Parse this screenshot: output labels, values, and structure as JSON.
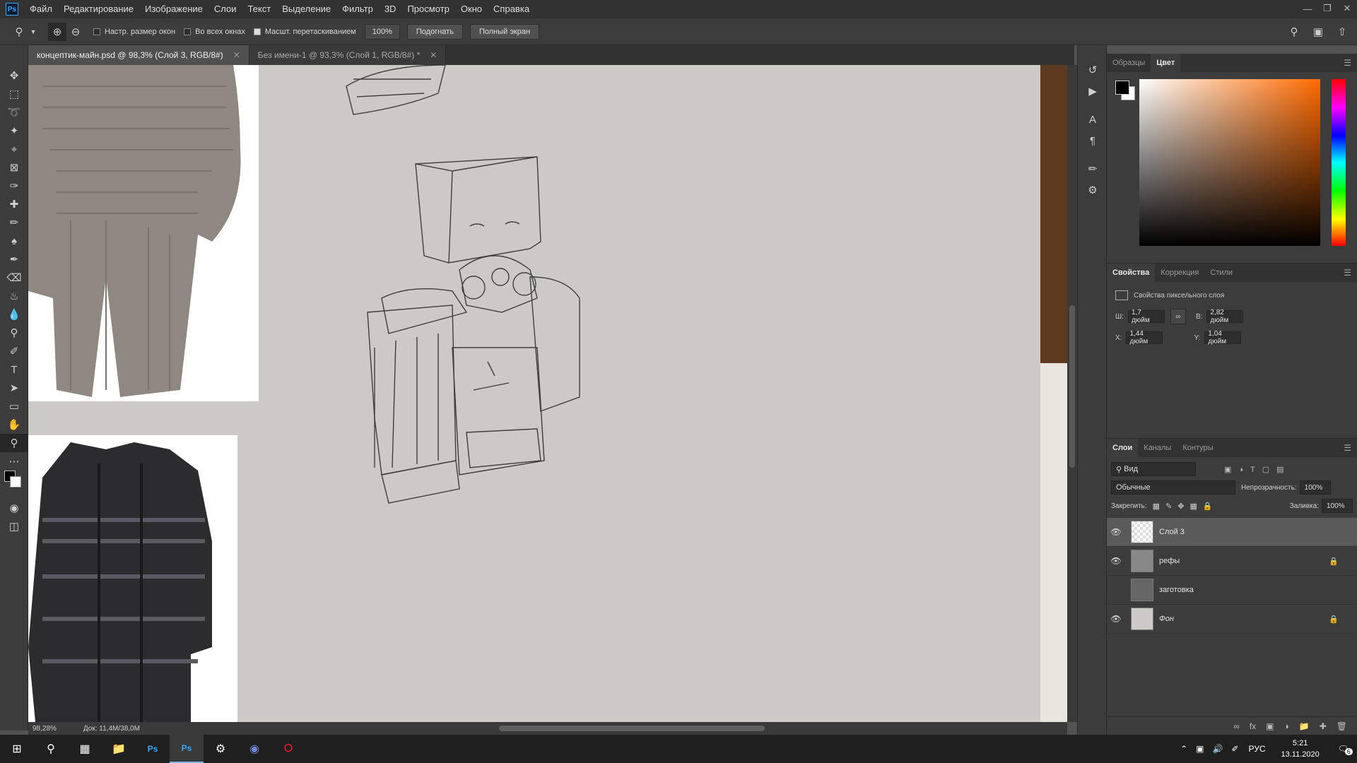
{
  "menu": [
    "Файл",
    "Редактирование",
    "Изображение",
    "Слои",
    "Текст",
    "Выделение",
    "Фильтр",
    "3D",
    "Просмотр",
    "Окно",
    "Справка"
  ],
  "options": {
    "resize_windows": "Настр. размер окон",
    "all_windows": "Во всех окнах",
    "scrubby_zoom": "Масшт. перетаскиванием",
    "zoom_value": "100%",
    "fit_button": "Подогнать",
    "fullscreen_button": "Полный экран"
  },
  "tabs": [
    {
      "label": "концептик-майн.psd @ 98,3% (Слой 3, RGB/8#)",
      "active": true
    },
    {
      "label": "Без имени-1 @ 93,3% (Слой 1, RGB/8#) *",
      "active": false
    }
  ],
  "status": {
    "zoom": "98,28%",
    "doc": "Док: 11,4M/38,0M"
  },
  "color_panel": {
    "tabs": [
      "Образцы",
      "Цвет"
    ],
    "active": "Цвет"
  },
  "properties": {
    "tabs": [
      "Свойства",
      "Коррекция",
      "Стили"
    ],
    "title": "Свойства пиксельного слоя",
    "w_label": "Ш:",
    "w": "1,7 дюйм",
    "h_label": "В:",
    "h": "2,82 дюйм",
    "x_label": "X:",
    "x": "1,44 дюйм",
    "y_label": "Y:",
    "y": "1,04 дюйм"
  },
  "layers_panel": {
    "tabs": [
      "Слои",
      "Каналы",
      "Контуры"
    ],
    "filter": "Вид",
    "blend_mode": "Обычные",
    "opacity_label": "Непрозрачность:",
    "opacity": "100%",
    "lock_label": "Закрепить:",
    "fill_label": "Заливка:",
    "fill": "100%",
    "layers": [
      {
        "name": "Слой 3",
        "visible": true,
        "locked": false,
        "selected": true
      },
      {
        "name": "рефы",
        "visible": true,
        "locked": true,
        "selected": false
      },
      {
        "name": "заготовка",
        "visible": false,
        "locked": false,
        "selected": false
      },
      {
        "name": "Фон",
        "visible": true,
        "locked": true,
        "selected": false
      }
    ]
  },
  "taskbar": {
    "lang": "РУС",
    "time": "5:21",
    "date": "13.11.2020",
    "notifications": "6"
  },
  "colors": {
    "foreground": "#000000",
    "background": "#ffffff",
    "accent": "#31a8ff"
  }
}
